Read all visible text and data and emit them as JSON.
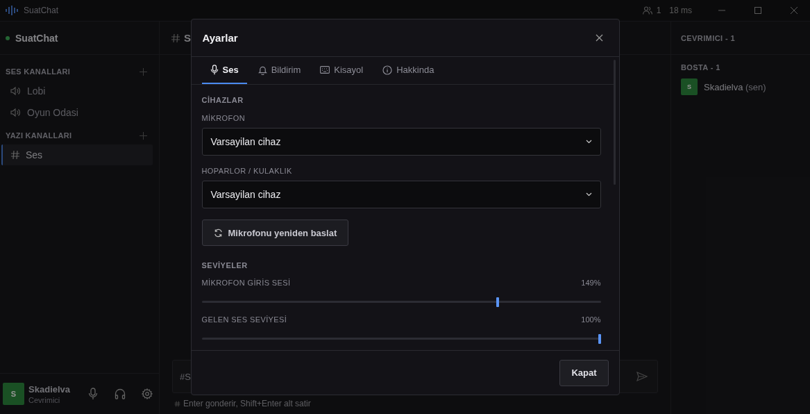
{
  "title_bar": {
    "app_name": "SuatChat",
    "online_count": "1",
    "ping": "18 ms"
  },
  "server": {
    "name": "SuatChat"
  },
  "sidebar": {
    "sections": [
      {
        "title": "SES KANALLARI",
        "kind": "voice",
        "channels": [
          {
            "name": "Lobi",
            "selected": false
          },
          {
            "name": "Oyun Odasi",
            "selected": false
          }
        ]
      },
      {
        "title": "YAZI KANALLARI",
        "kind": "text",
        "channels": [
          {
            "name": "Ses",
            "selected": true
          }
        ]
      }
    ]
  },
  "user_panel": {
    "avatar": "S",
    "name": "Skadielva",
    "status": "Cevrimici"
  },
  "channel_header": {
    "title": "S"
  },
  "composer": {
    "placeholder": "#S",
    "hint": "Enter gonderir, Shift+Enter alt satir"
  },
  "members": {
    "header": "CEVRIMICI - 1",
    "groups": [
      {
        "title": "BOSTA - 1",
        "members": [
          {
            "avatar": "S",
            "name": "Skadielva",
            "suffix": "(sen)"
          }
        ]
      }
    ]
  },
  "dialog": {
    "title": "Ayarlar",
    "tabs": [
      {
        "label": "Ses",
        "kind": "mic",
        "selected": true
      },
      {
        "label": "Bildirim",
        "kind": "bell",
        "selected": false
      },
      {
        "label": "Kisayol",
        "kind": "keyboard",
        "selected": false
      },
      {
        "label": "Hakkinda",
        "kind": "info",
        "selected": false
      }
    ],
    "devices": {
      "title": "CİHAZLAR",
      "fields": [
        {
          "label": "MİKROFON",
          "value": "Varsayilan cihaz"
        },
        {
          "label": "HOPARLOR / KULAKLIK",
          "value": "Varsayilan cihaz"
        }
      ],
      "restart_button": "Mikrofonu yeniden baslat"
    },
    "levels": {
      "title": "SEVİYELER",
      "sliders": [
        {
          "label": "MİKROFON GİRİS SESİ",
          "reading": "149%",
          "level": 0.744
        },
        {
          "label": "GELEN SES SEVİYESİ",
          "reading": "100%",
          "level": 1
        }
      ]
    },
    "close_button": "Kapat"
  }
}
